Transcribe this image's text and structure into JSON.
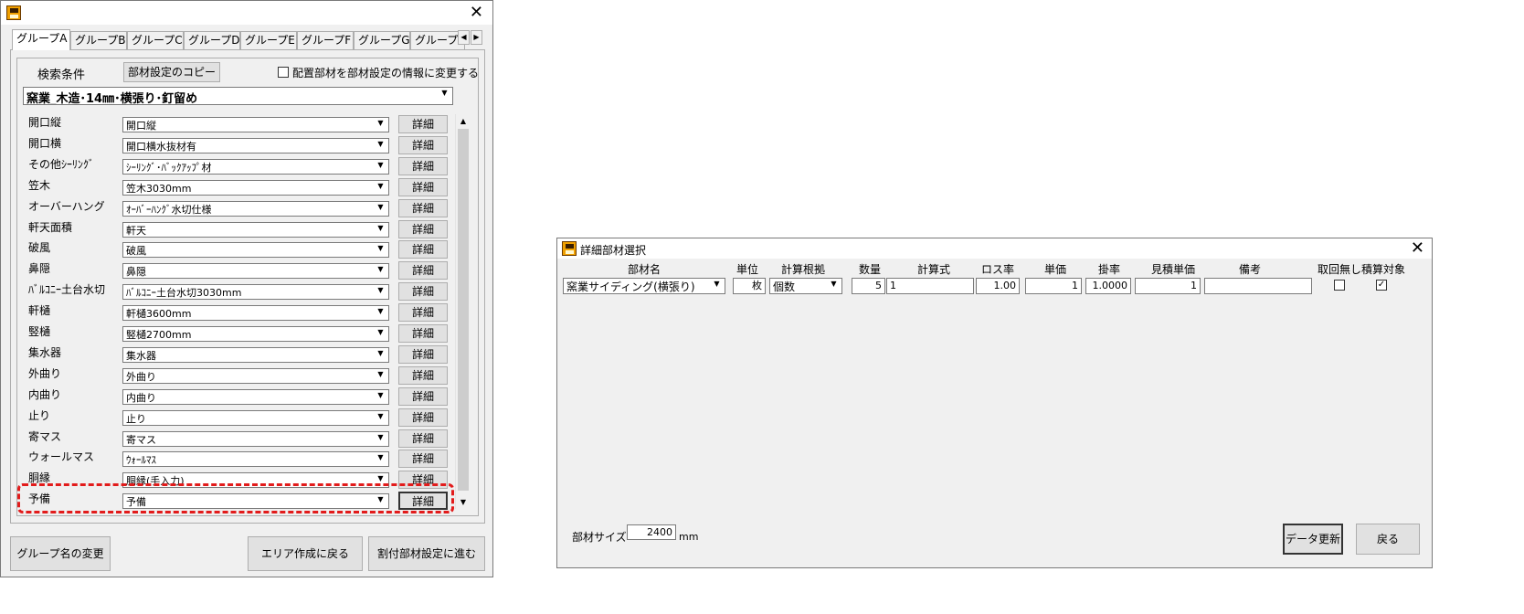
{
  "left_window": {
    "tabs": [
      "グループA",
      "グループB",
      "グループC",
      "グループD",
      "グループE",
      "グループF",
      "グループG",
      "グループH"
    ],
    "search_label": "検索条件",
    "copy_button": "部材設定のコピー",
    "checkbox_label": "配置部材を部材設定の情報に変更する",
    "main_combo_value": "窯業_木造･14㎜･横張り･釘留め",
    "detail_label": "詳細",
    "rows": [
      {
        "label": "開口縦",
        "value": "開口縦"
      },
      {
        "label": "開口横",
        "value": "開口横水抜材有"
      },
      {
        "label": "その他ｼｰﾘﾝｸﾞ",
        "value": "ｼｰﾘﾝｸﾞ･ﾊﾞｯｸｱｯﾌﾟ材"
      },
      {
        "label": "笠木",
        "value": "笠木3030mm"
      },
      {
        "label": "オーバーハング",
        "value": "ｵｰﾊﾞｰﾊﾝｸﾞ水切仕様"
      },
      {
        "label": "軒天面積",
        "value": "軒天"
      },
      {
        "label": "破風",
        "value": "破風"
      },
      {
        "label": "鼻隠",
        "value": "鼻隠"
      },
      {
        "label": "ﾊﾞﾙｺﾆｰ土台水切",
        "value": "ﾊﾞﾙｺﾆｰ土台水切3030mm"
      },
      {
        "label": "軒樋",
        "value": "軒樋3600mm"
      },
      {
        "label": "竪樋",
        "value": "竪樋2700mm"
      },
      {
        "label": "集水器",
        "value": "集水器"
      },
      {
        "label": "外曲り",
        "value": "外曲り"
      },
      {
        "label": "内曲り",
        "value": "内曲り"
      },
      {
        "label": "止り",
        "value": "止り"
      },
      {
        "label": "寄マス",
        "value": "寄マス"
      },
      {
        "label": "ウォールマス",
        "value": "ｳｫｰﾙﾏｽ"
      },
      {
        "label": "胴縁",
        "value": "胴縁(手入力)"
      },
      {
        "label": "予備",
        "value": "予備"
      }
    ],
    "bottom_buttons": {
      "rename": "グループ名の変更",
      "back_area": "エリア作成に戻る",
      "next": "割付部材設定に進む"
    },
    "colors": {
      "highlight": "#e21b1b"
    }
  },
  "right_window": {
    "title": "詳細部材選択",
    "headers": {
      "part_name": "部材名",
      "unit": "単位",
      "calc_basis": "計算根拠",
      "quantity": "数量",
      "formula": "計算式",
      "loss_rate": "ロス率",
      "unit_price": "単価",
      "rate": "掛率",
      "est_unit_price": "見積単価",
      "remarks": "備考",
      "no_recovery": "取回無し",
      "estimate_target": "積算対象"
    },
    "row": {
      "part_name": "窯業サイディング(横張り)",
      "unit": "枚",
      "calc_basis": "個数",
      "quantity": "5",
      "formula": "1",
      "loss_rate": "1.00",
      "unit_price": "1",
      "rate": "1.0000",
      "est_unit_price": "1",
      "remarks": "",
      "no_recovery_checked": false,
      "estimate_target_checked": true
    },
    "size_label": "部材サイズ",
    "size_value": "2400",
    "size_unit": "mm",
    "update_button": "データ更新",
    "back_button": "戻る"
  }
}
